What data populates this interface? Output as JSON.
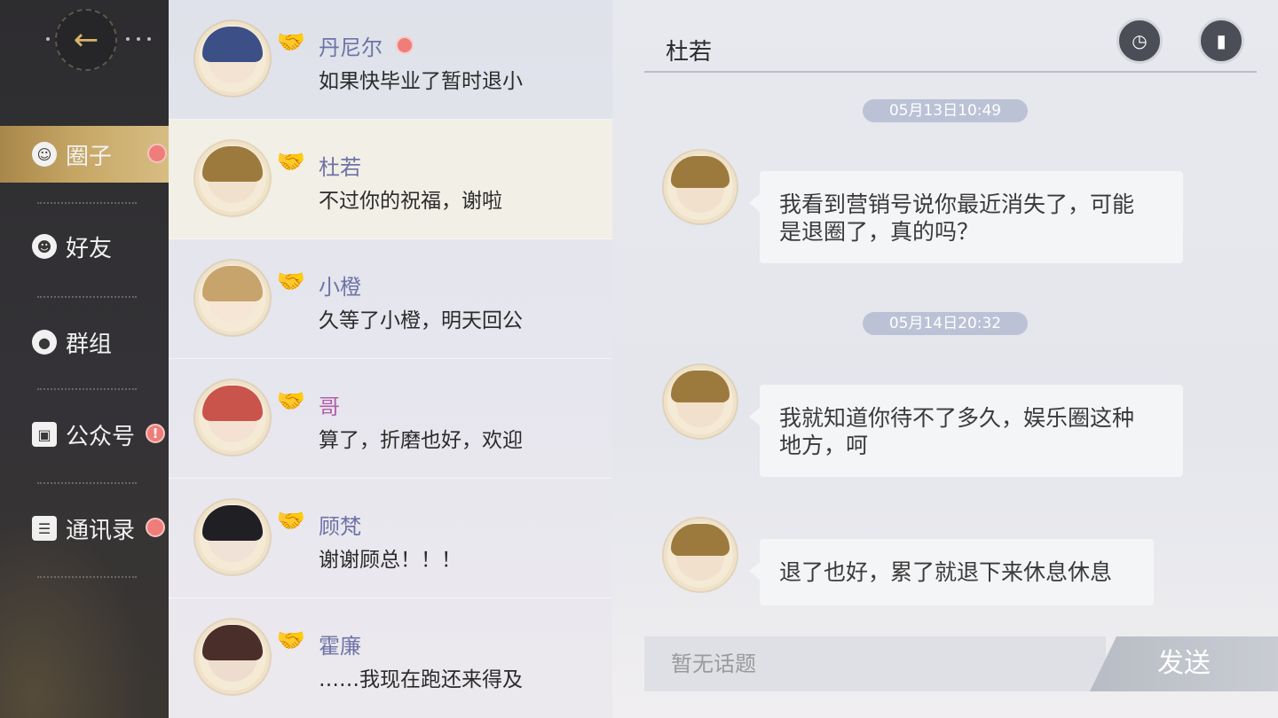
{
  "nav": {
    "back_icon": "arrow-left-icon",
    "items": [
      {
        "label": "圈子",
        "icon": "smile-icon",
        "badge": "dot"
      },
      {
        "label": "好友",
        "icon": "person-icon",
        "badge": ""
      },
      {
        "label": "群组",
        "icon": "group-icon",
        "badge": ""
      },
      {
        "label": "公众号",
        "icon": "picture-icon",
        "badge": "!"
      },
      {
        "label": "通讯录",
        "icon": "contacts-icon",
        "badge": "dot"
      }
    ]
  },
  "contacts": [
    {
      "name": "丹尼尔",
      "message": "如果快毕业了暂时退小",
      "unread": true
    },
    {
      "name": "杜若",
      "message": "不过你的祝福，谢啦",
      "unread": false
    },
    {
      "name": "小橙",
      "message": "久等了小橙，明天回公",
      "unread": false
    },
    {
      "name": "哥",
      "message": "算了，折磨也好，欢迎",
      "unread": false
    },
    {
      "name": "顾梵",
      "message": "谢谢顾总！！！",
      "unread": false
    },
    {
      "name": "霍廉",
      "message": "……我现在跑还来得及",
      "unread": false
    }
  ],
  "chat": {
    "title": "杜若",
    "top_buttons": [
      "history-video-icon",
      "camera-icon"
    ],
    "timestamps": [
      "05月13日10:49",
      "05月14日20:32"
    ],
    "messages": [
      {
        "line1": "我看到营销号说你最近消失了，可能",
        "line2": "是退圈了，真的吗？"
      },
      {
        "line1": "我就知道你待不了多久，娱乐圈这种",
        "line2": "地方，呵"
      },
      {
        "line1": "退了也好，累了就退下来休息休息",
        "line2": ""
      }
    ],
    "input_placeholder": "暂无话题",
    "send_label": "发送"
  },
  "colors": {
    "accent_gold": "#c6a665",
    "unread_red": "#ef7d7a",
    "name_purple": "#6e73a6",
    "name_pink": "#b060a8"
  }
}
